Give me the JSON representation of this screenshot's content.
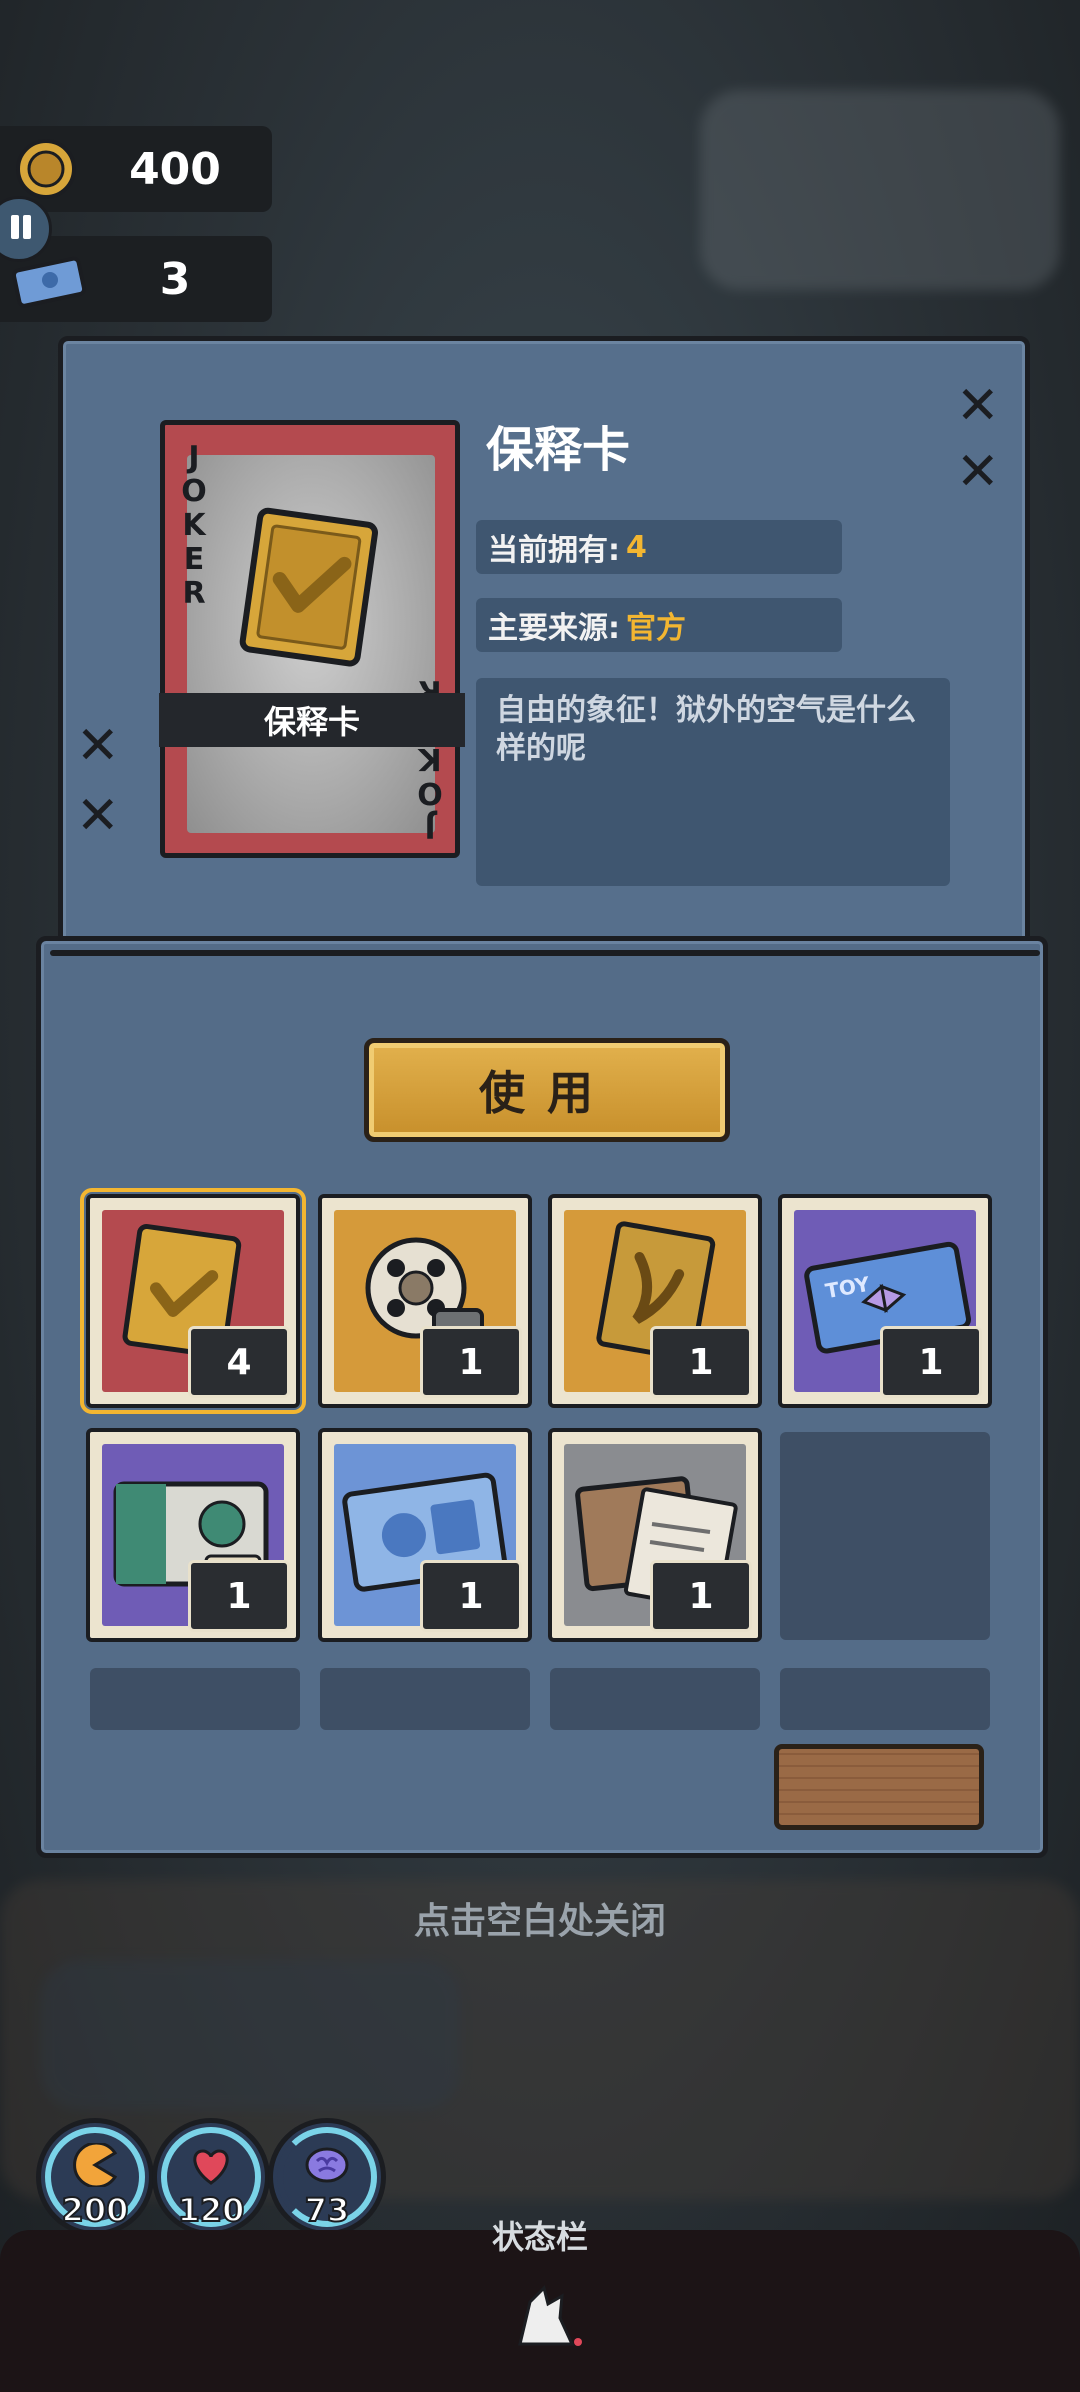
{
  "resources": {
    "coins": "400",
    "tickets": "3"
  },
  "item_detail": {
    "title": "保释卡",
    "card_band_label": "保释卡",
    "joker_text": "JOKER",
    "owned_label": "当前拥有:",
    "owned_value": "4",
    "source_label": "主要来源:",
    "source_value": "官方",
    "description": "自由的象征！狱外的空气是什么样的呢"
  },
  "use_button_label": "使用",
  "inventory": {
    "slots": [
      {
        "count": "4",
        "icon": "bail-card-icon"
      },
      {
        "count": "1",
        "icon": "film-reel-icon"
      },
      {
        "count": "1",
        "icon": "gold-card-icon"
      },
      {
        "count": "1",
        "icon": "toy-ticket-icon"
      },
      {
        "count": "1",
        "icon": "green-card-icon"
      },
      {
        "count": "1",
        "icon": "blue-photo-icon"
      },
      {
        "count": "1",
        "icon": "document-envelope-icon"
      }
    ]
  },
  "close_hint": "点击空白处关闭",
  "stats": [
    {
      "value": "200",
      "icon": "hunger-icon"
    },
    {
      "value": "120",
      "icon": "heart-icon"
    },
    {
      "value": "73",
      "icon": "brain-icon"
    }
  ],
  "status_bar_label": "状态栏",
  "colors": {
    "accent_gold": "#f3b631",
    "panel_blue": "#566f8c",
    "card_red": "#b44a4f"
  }
}
